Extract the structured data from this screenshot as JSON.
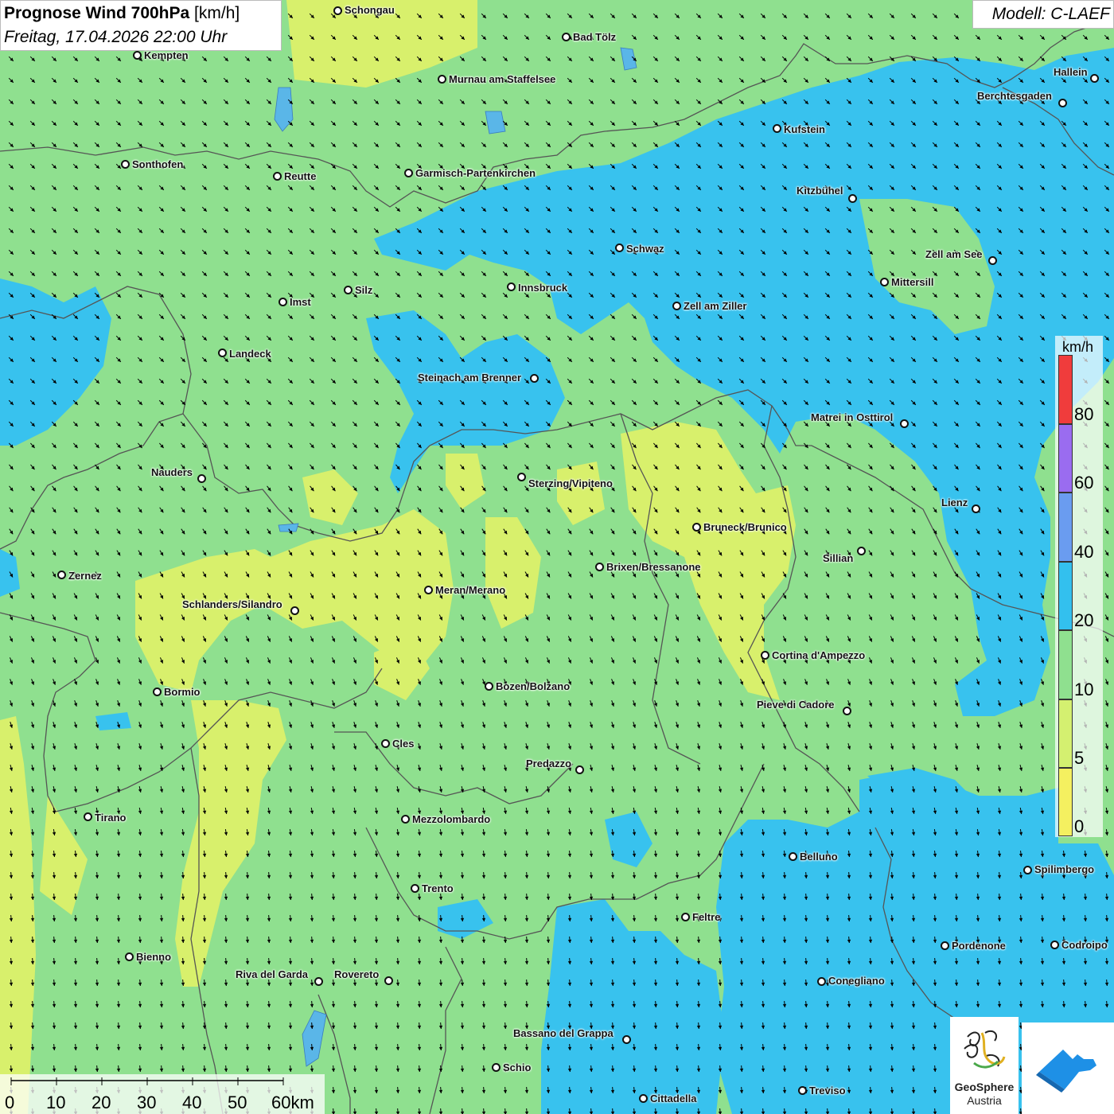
{
  "title": {
    "main": "Prognose Wind 700hPa",
    "unit": "[km/h]",
    "datetime": "Freitag, 17.04.2026 22:00 Uhr"
  },
  "model": "Modell: C-LAEF",
  "legend": {
    "unit": "km/h",
    "labels": [
      "80",
      "60",
      "40",
      "20",
      "10",
      "5",
      "0"
    ],
    "colors": [
      "#f03c3c",
      "#9a6cf0",
      "#6a9cf0",
      "#33c0ee",
      "#8fe08f",
      "#d4f070",
      "#f4f060"
    ]
  },
  "scale": {
    "labels": [
      "0",
      "10",
      "20",
      "30",
      "40",
      "50",
      "60km"
    ]
  },
  "logo": {
    "name_line1": "GeoSphere",
    "name_line2": "Austria"
  },
  "colors": {
    "background_green": "#8fe08f",
    "blue_zone": "#38c2ee",
    "yellow_zone": "#d8f06c",
    "border": "#555555",
    "arrow": "#000000",
    "logo_blue": "#1e90e6"
  },
  "cities": [
    {
      "name": "Schongau",
      "dot": [
        424,
        13
      ],
      "label": [
        433,
        5
      ]
    },
    {
      "name": "Bad Tölz",
      "dot": [
        711,
        46
      ],
      "label": [
        720,
        39
      ]
    },
    {
      "name": "Kempten",
      "dot": [
        172,
        69
      ],
      "label": [
        181,
        62
      ]
    },
    {
      "name": "Murnau am Staffelsee",
      "dot": [
        555,
        99
      ],
      "label": [
        564,
        92
      ]
    },
    {
      "name": "Hallein",
      "dot": [
        1375,
        98
      ],
      "label": [
        1324,
        83
      ]
    },
    {
      "name": "Berchtesgaden",
      "dot": [
        1335,
        129
      ],
      "label": [
        1228,
        113
      ]
    },
    {
      "name": "Kufstein",
      "dot": [
        976,
        161
      ],
      "label": [
        985,
        155
      ]
    },
    {
      "name": "Sonthofen",
      "dot": [
        157,
        206
      ],
      "label": [
        166,
        199
      ]
    },
    {
      "name": "Reutte",
      "dot": [
        348,
        221
      ],
      "label": [
        357,
        214
      ]
    },
    {
      "name": "Garmisch-Partenkirchen",
      "dot": [
        513,
        217
      ],
      "label": [
        522,
        210
      ]
    },
    {
      "name": "Kitzbühel",
      "dot": [
        1071,
        249
      ],
      "label": [
        1001,
        232
      ]
    },
    {
      "name": "Schwaz",
      "dot": [
        778,
        311
      ],
      "label": [
        787,
        305
      ]
    },
    {
      "name": "Zell am See",
      "dot": [
        1247,
        327
      ],
      "label": [
        1163,
        312
      ]
    },
    {
      "name": "Mittersill",
      "dot": [
        1111,
        354
      ],
      "label": [
        1120,
        347
      ]
    },
    {
      "name": "Innsbruck",
      "dot": [
        642,
        360
      ],
      "label": [
        651,
        354
      ]
    },
    {
      "name": "Silz",
      "dot": [
        437,
        364
      ],
      "label": [
        446,
        357
      ]
    },
    {
      "name": "Imst",
      "dot": [
        355,
        379
      ],
      "label": [
        364,
        372
      ]
    },
    {
      "name": "Zell am Ziller",
      "dot": [
        850,
        384
      ],
      "label": [
        859,
        377
      ]
    },
    {
      "name": "Landeck",
      "dot": [
        279,
        443
      ],
      "label": [
        288,
        437
      ]
    },
    {
      "name": "Steinach am Brenner",
      "dot": [
        671,
        475
      ],
      "label": [
        525,
        467
      ]
    },
    {
      "name": "Matrei in Osttirol",
      "dot": [
        1136,
        532
      ],
      "label": [
        1019,
        517
      ]
    },
    {
      "name": "Nauders",
      "dot": [
        253,
        601
      ],
      "label": [
        190,
        586
      ]
    },
    {
      "name": "Sterzing/Vipiteno",
      "dot": [
        655,
        599
      ],
      "label": [
        664,
        600
      ]
    },
    {
      "name": "Lienz",
      "dot": [
        1226,
        639
      ],
      "label": [
        1183,
        624
      ]
    },
    {
      "name": "Bruneck/Brunico",
      "dot": [
        875,
        662
      ],
      "label": [
        884,
        655
      ]
    },
    {
      "name": "Sillian",
      "dot": [
        1082,
        692
      ],
      "label": [
        1034,
        694
      ]
    },
    {
      "name": "Brixen/Bressanone",
      "dot": [
        753,
        712
      ],
      "label": [
        762,
        705
      ]
    },
    {
      "name": "Zernez",
      "dot": [
        77,
        722
      ],
      "label": [
        86,
        716
      ]
    },
    {
      "name": "Meran/Merano",
      "dot": [
        538,
        741
      ],
      "label": [
        547,
        734
      ]
    },
    {
      "name": "Schlanders/Silandro",
      "dot": [
        370,
        767
      ],
      "label": [
        229,
        752
      ]
    },
    {
      "name": "Cortina d'Ampezzo",
      "dot": [
        961,
        823
      ],
      "label": [
        970,
        816
      ]
    },
    {
      "name": "Bozen/Bolzano",
      "dot": [
        614,
        862
      ],
      "label": [
        623,
        855
      ]
    },
    {
      "name": "Bormio",
      "dot": [
        197,
        869
      ],
      "label": [
        206,
        862
      ]
    },
    {
      "name": "Pieve di Cadore",
      "dot": [
        1064,
        893
      ],
      "label": [
        951,
        878
      ]
    },
    {
      "name": "Cles",
      "dot": [
        484,
        934
      ],
      "label": [
        493,
        927
      ]
    },
    {
      "name": "Predazzo",
      "dot": [
        728,
        967
      ],
      "label": [
        661,
        952
      ]
    },
    {
      "name": "Tirano",
      "dot": [
        110,
        1026
      ],
      "label": [
        119,
        1020
      ]
    },
    {
      "name": "Mezzolombardo",
      "dot": [
        509,
        1029
      ],
      "label": [
        518,
        1022
      ]
    },
    {
      "name": "Belluno",
      "dot": [
        996,
        1076
      ],
      "label": [
        1005,
        1069
      ]
    },
    {
      "name": "Spilimbergo",
      "dot": [
        1291,
        1093
      ],
      "label": [
        1300,
        1085
      ]
    },
    {
      "name": "Trento",
      "dot": [
        521,
        1116
      ],
      "label": [
        530,
        1109
      ]
    },
    {
      "name": "Feltre",
      "dot": [
        861,
        1152
      ],
      "label": [
        870,
        1145
      ]
    },
    {
      "name": "Pordenone",
      "dot": [
        1187,
        1188
      ],
      "label": [
        1196,
        1181
      ]
    },
    {
      "name": "Codroipo",
      "dot": [
        1325,
        1187
      ],
      "label": [
        1334,
        1180
      ]
    },
    {
      "name": "Bienno",
      "dot": [
        162,
        1202
      ],
      "label": [
        171,
        1195
      ]
    },
    {
      "name": "Riva del Garda",
      "dot": [
        400,
        1233
      ],
      "label": [
        296,
        1217
      ]
    },
    {
      "name": "Rovereto",
      "dot": [
        488,
        1232
      ],
      "label": [
        420,
        1217
      ]
    },
    {
      "name": "Conegliano",
      "dot": [
        1032,
        1233
      ],
      "label": [
        1041,
        1225
      ]
    },
    {
      "name": "Bassano del Grappa",
      "dot": [
        787,
        1306
      ],
      "label": [
        645,
        1291
      ]
    },
    {
      "name": "Schio",
      "dot": [
        623,
        1341
      ],
      "label": [
        632,
        1334
      ]
    },
    {
      "name": "Treviso",
      "dot": [
        1008,
        1370
      ],
      "label": [
        1017,
        1363
      ]
    },
    {
      "name": "Cittadella",
      "dot": [
        808,
        1380
      ],
      "label": [
        817,
        1373
      ]
    }
  ]
}
